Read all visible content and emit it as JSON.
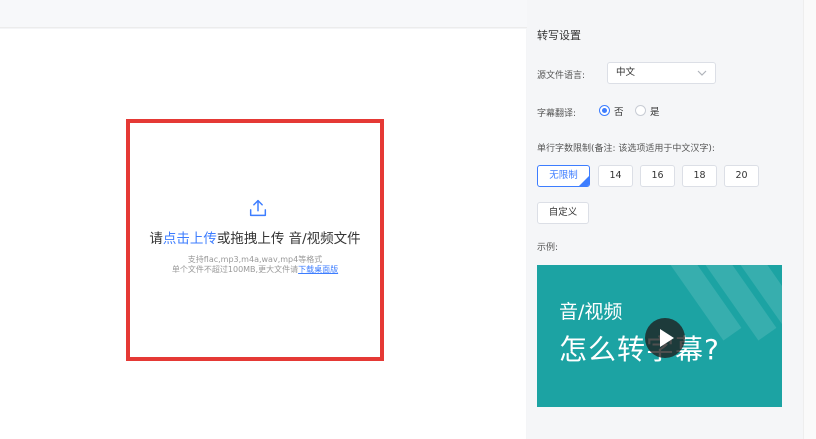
{
  "upload": {
    "prefix": "请",
    "link": "点击上传",
    "suffix": "或拖拽上传 音/视频文件",
    "formats": "支持flac,mp3,m4a,wav,mp4等格式",
    "size_note": "单个文件不超过100MB,更大文件请",
    "download_link": "下载桌面版"
  },
  "settings": {
    "title": "转写设置",
    "lang_label": "源文件语言:",
    "lang_value": "中文",
    "translate_label": "字幕翻译:",
    "translate_no": "否",
    "translate_yes": "是",
    "translate_selected": "否",
    "limit_label": "单行字数限制(备注: 该选项适用于中文汉字):",
    "limit_options": [
      "无限制",
      "14",
      "16",
      "18",
      "20"
    ],
    "limit_selected": "无限制",
    "custom_label": "自定义",
    "example_label": "示例:"
  },
  "preview": {
    "line1": "音/视频",
    "line2": "怎么转字幕?"
  },
  "colors": {
    "accent": "#3d7dff",
    "drop_border": "#e53935",
    "preview_bg": "#1ca3a3"
  }
}
